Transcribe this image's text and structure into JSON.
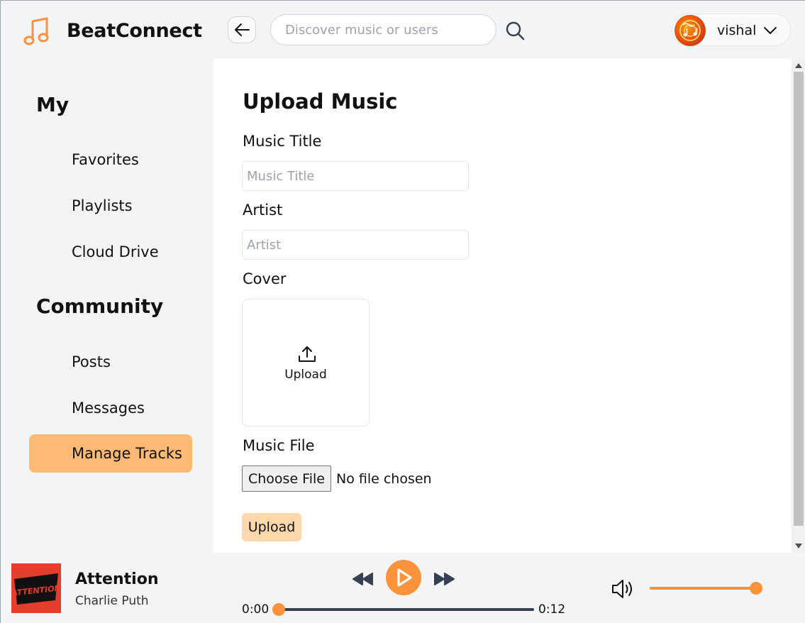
{
  "app": {
    "name": "BeatConnect",
    "accent": "#fb923c"
  },
  "header": {
    "search_placeholder": "Discover music or users",
    "username": "vishal"
  },
  "sidebar": {
    "sections": [
      {
        "title": "My",
        "items": [
          "Favorites",
          "Playlists",
          "Cloud Drive"
        ]
      },
      {
        "title": "Community",
        "items": [
          "Posts",
          "Messages",
          "Manage Tracks"
        ]
      }
    ],
    "active_item": "Manage Tracks"
  },
  "upload_form": {
    "title": "Upload Music",
    "music_title_label": "Music Title",
    "music_title_placeholder": "Music Title",
    "artist_label": "Artist",
    "artist_placeholder": "Artist",
    "cover_label": "Cover",
    "cover_upload_text": "Upload",
    "music_file_label": "Music File",
    "choose_file_label": "Choose File",
    "file_status": "No file chosen",
    "submit_label": "Upload"
  },
  "player": {
    "track_title": "Attention",
    "track_artist": "Charlie Puth",
    "cover_text": "ATTENTION",
    "current_time": "0:00",
    "total_time": "0:12",
    "progress": 0,
    "volume": 1.0
  }
}
